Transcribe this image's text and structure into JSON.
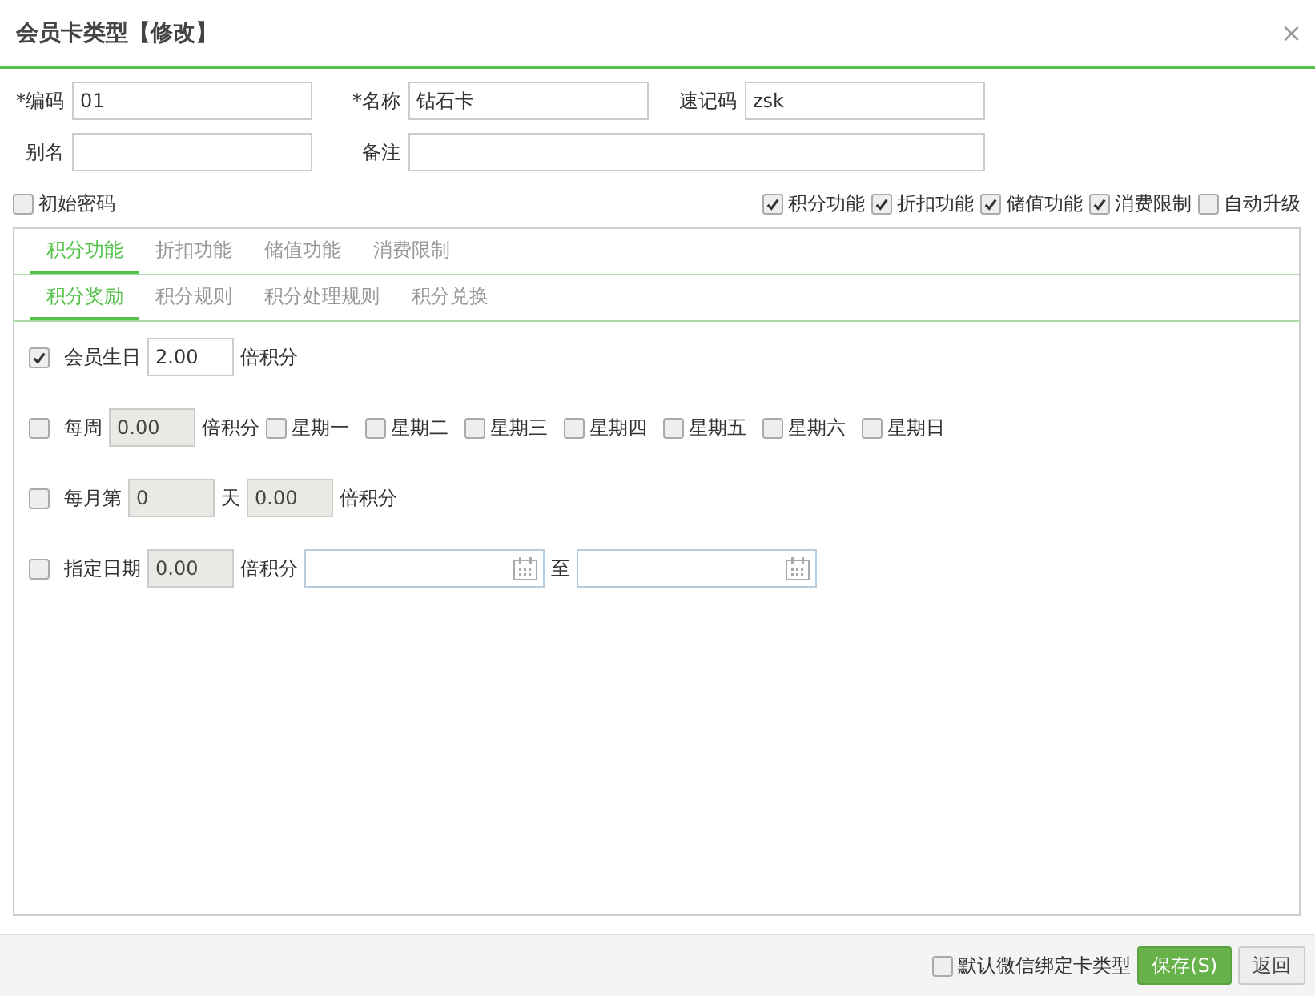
{
  "window": {
    "title": "会员卡类型【修改】",
    "close": "×"
  },
  "field_rows": [
    [
      {
        "label": "*编码",
        "value": "01"
      },
      {
        "label": "*名称",
        "value": "钻石卡"
      },
      {
        "label": "速记码",
        "value": "zsk"
      }
    ],
    [
      {
        "label": "别名"
      },
      {
        "label": "备注"
      }
    ]
  ],
  "options_left": [
    {
      "label": "初始密码",
      "checked": false
    }
  ],
  "options_right": [
    {
      "label": "积分功能",
      "checked": true
    },
    {
      "label": "折扣功能",
      "checked": true
    },
    {
      "label": "储值功能",
      "checked": true
    },
    {
      "label": "消费限制",
      "checked": true
    },
    {
      "label": "自动升级",
      "checked": false
    }
  ],
  "tabs": [
    {
      "label": "积分功能",
      "selected": true
    },
    {
      "label": "折扣功能",
      "selected": false
    },
    {
      "label": "储值功能",
      "selected": false
    },
    {
      "label": "消费限制",
      "selected": false
    }
  ],
  "subtabs": [
    {
      "label": "积分奖励",
      "selected": true
    },
    {
      "label": "积分规则",
      "selected": false
    },
    {
      "label": "积分处理规则",
      "selected": false
    },
    {
      "label": "积分兑换",
      "selected": false
    }
  ],
  "rules": [
    {
      "checked": true,
      "label": "会员生日",
      "parts": [
        {
          "kind": "input",
          "value": "2.00",
          "disabled": false
        },
        {
          "kind": "text",
          "text": "倍积分"
        }
      ]
    },
    {
      "checked": false,
      "label": "每周",
      "parts": [
        {
          "kind": "input",
          "value": "0.00",
          "disabled": true
        },
        {
          "kind": "text",
          "text": "倍积分"
        },
        {
          "kind": "check",
          "label": "星期一",
          "checked": false
        },
        {
          "kind": "check",
          "label": "星期二",
          "checked": false
        },
        {
          "kind": "check",
          "label": "星期三",
          "checked": false
        },
        {
          "kind": "check",
          "label": "星期四",
          "checked": false
        },
        {
          "kind": "check",
          "label": "星期五",
          "checked": false
        },
        {
          "kind": "check",
          "label": "星期六",
          "checked": false
        },
        {
          "kind": "check",
          "label": "星期日",
          "checked": false
        }
      ]
    },
    {
      "checked": false,
      "label": "每月第",
      "parts": [
        {
          "kind": "input",
          "value": "0",
          "disabled": true
        },
        {
          "kind": "text",
          "text": "天"
        },
        {
          "kind": "input",
          "value": "0.00",
          "disabled": true
        },
        {
          "kind": "text",
          "text": "倍积分"
        }
      ]
    },
    {
      "checked": false,
      "label": "指定日期",
      "parts": [
        {
          "kind": "input",
          "value": "0.00",
          "disabled": true
        },
        {
          "kind": "text",
          "text": "倍积分"
        },
        {
          "kind": "date"
        },
        {
          "kind": "text",
          "text": "至"
        },
        {
          "kind": "date"
        }
      ]
    }
  ],
  "footer": {
    "option": {
      "label": "默认微信绑定卡类型",
      "checked": false
    },
    "buttons": [
      {
        "label": "保存(S)",
        "kind": "primary"
      },
      {
        "label": "返回",
        "kind": "default"
      }
    ]
  }
}
